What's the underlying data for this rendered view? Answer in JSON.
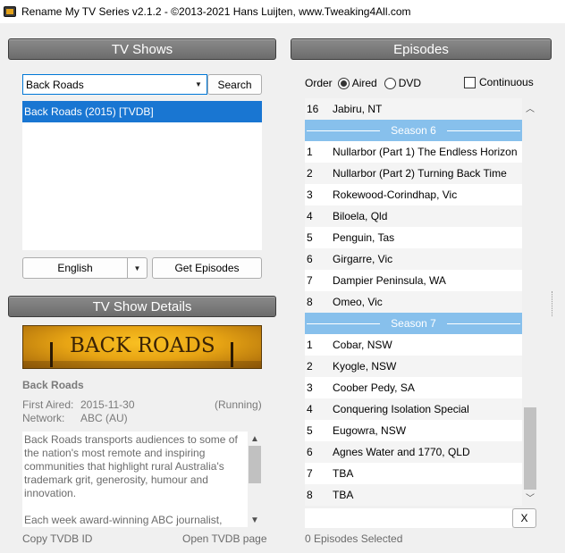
{
  "window": {
    "title": "Rename My TV Series v2.1.2 - ©2013-2021 Hans Luijten, www.Tweaking4All.com"
  },
  "tv_shows": {
    "header": "TV Shows",
    "search_value": "Back Roads",
    "search_button": "Search",
    "results": [
      "Back Roads (2015) [TVDB]"
    ],
    "language": "English",
    "get_episodes_button": "Get Episodes"
  },
  "details": {
    "header": "TV Show Details",
    "poster_text": "BACK ROADS",
    "show_name": "Back Roads",
    "first_aired_label": "First Aired:",
    "first_aired_value": "2015-11-30",
    "status": "(Running)",
    "network_label": "Network:",
    "network_value": "ABC (AU)",
    "description": "Back Roads transports audiences to some of the nation's most remote and inspiring communities that highlight rural Australia's trademark grit, generosity, humour and innovation.\n\nEach week award-winning ABC journalist, Heather Ewart heads to a new corner of Australia...",
    "copy_link": "Copy TVDB ID",
    "open_link": "Open TVDB page"
  },
  "episodes": {
    "header": "Episodes",
    "order_label": "Order",
    "aired_label": "Aired",
    "dvd_label": "DVD",
    "continuous_label": "Continuous",
    "rows": [
      {
        "type": "ep",
        "num": "16",
        "title": "Jabiru, NT"
      },
      {
        "type": "season",
        "title": "Season 6"
      },
      {
        "type": "ep",
        "num": "1",
        "title": "Nullarbor (Part 1) The Endless Horizon"
      },
      {
        "type": "ep",
        "num": "2",
        "title": "Nullarbor (Part 2) Turning Back Time"
      },
      {
        "type": "ep",
        "num": "3",
        "title": "Rokewood-Corindhap, Vic"
      },
      {
        "type": "ep",
        "num": "4",
        "title": "Biloela, Qld"
      },
      {
        "type": "ep",
        "num": "5",
        "title": "Penguin, Tas"
      },
      {
        "type": "ep",
        "num": "6",
        "title": "Girgarre, Vic"
      },
      {
        "type": "ep",
        "num": "7",
        "title": "Dampier Peninsula, WA"
      },
      {
        "type": "ep",
        "num": "8",
        "title": "Omeo, Vic"
      },
      {
        "type": "season",
        "title": "Season 7"
      },
      {
        "type": "ep",
        "num": "1",
        "title": "Cobar, NSW"
      },
      {
        "type": "ep",
        "num": "2",
        "title": "Kyogle, NSW"
      },
      {
        "type": "ep",
        "num": "3",
        "title": "Coober Pedy, SA"
      },
      {
        "type": "ep",
        "num": "4",
        "title": "Conquering Isolation Special"
      },
      {
        "type": "ep",
        "num": "5",
        "title": "Eugowra, NSW"
      },
      {
        "type": "ep",
        "num": "6",
        "title": "Agnes Water and 1770, QLD"
      },
      {
        "type": "ep",
        "num": "7",
        "title": "TBA"
      },
      {
        "type": "ep",
        "num": "8",
        "title": "TBA"
      }
    ],
    "clear_button": "X",
    "selected_status": "0 Episodes Selected"
  }
}
